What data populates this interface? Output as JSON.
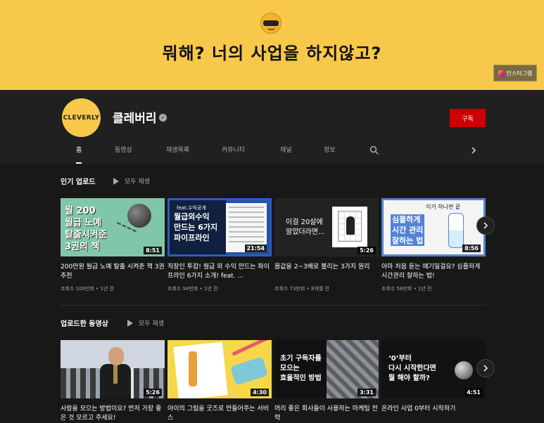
{
  "banner": {
    "slogan": "뭐해? 너의 사업을 하지않고?",
    "emoji_icon": "sunglasses-face-emoji",
    "instagram_label": "인스타그램"
  },
  "channel": {
    "avatar_text": "CLEVERLY",
    "name": "클레버리",
    "subscribe_label": "구독"
  },
  "tabs": [
    {
      "label": "홈"
    },
    {
      "label": "동영상"
    },
    {
      "label": "재생목록"
    },
    {
      "label": "커뮤니티"
    },
    {
      "label": "채널"
    },
    {
      "label": "정보"
    }
  ],
  "sections": [
    {
      "title": "인기 업로드",
      "play_all": "모두 재생",
      "videos": [
        {
          "title": "200만원 월급 노예 탈출 시켜준 책 3권 추천",
          "duration": "8:51",
          "views": "조회수 100만회",
          "age": "1년 전",
          "thumb_text": "월 200\n월급 노예\n탈출시켜준\n3권의 책"
        },
        {
          "title": "직장인 투잡! 월급 외 수익 만드는 파이프라인 6가지 소개! feat. ...",
          "duration": "21:54",
          "views": "조회수 94만회",
          "age": "1년 전",
          "thumb_tag": "feat.수익공개",
          "thumb_text": "월급외수익\n만드는 6가지\n파이프라인"
        },
        {
          "title": "몸값을 2~3배로 불리는 3가지 원리",
          "duration": "5:26",
          "views": "조회수 73만회",
          "age": "8개월 전",
          "thumb_text": "이걸 20살에\n알았더라면..."
        },
        {
          "title": "아마 처음 듣는 얘기일걸요? 심플하게 시간관리 잘하는 법!",
          "duration": "8:56",
          "views": "조회수 58만회",
          "age": "1년 전",
          "thumb_top": "이거 하나면 끝",
          "thumb_text": "심플하게\n시간 관리\n잘하는 법"
        }
      ]
    },
    {
      "title": "업로드한 동영상",
      "play_all": "모두 재생",
      "videos": [
        {
          "title": "사람을 모으는 방법이요? 먼저 가장 좋은 것 모르고 주세요!",
          "duration": "5:26"
        },
        {
          "title": "아이의 그림을 굿즈로 만들어주는 서비스",
          "duration": "4:30"
        },
        {
          "title": "머리 좋은 회사들이 사용하는 마케팅 전략",
          "duration": "3:31",
          "thumb_text": "초기 구독자를\n모으는\n효율적인 방법"
        },
        {
          "title": "온라인 사업 0부터 시작하기",
          "duration": "4:51",
          "thumb_text": "‘0’부터\n다시 시작한다면\n뭘 해야 할까?"
        }
      ]
    }
  ],
  "icons": {
    "search": "search-icon",
    "next": "chevron-right-icon",
    "verified": "verified-check-icon",
    "play": "play-icon",
    "instagram": "instagram-icon"
  },
  "colors": {
    "banner": "#f8c84a",
    "subscribe": "#cc0000",
    "background": "#181818"
  }
}
